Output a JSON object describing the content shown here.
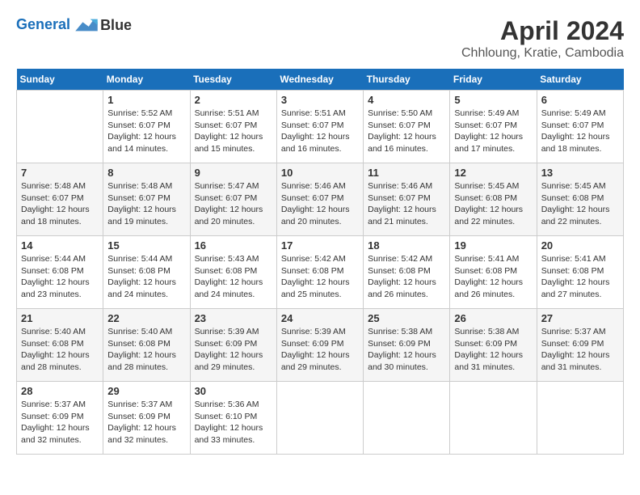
{
  "header": {
    "logo_line1": "General",
    "logo_line2": "Blue",
    "month_title": "April 2024",
    "location": "Chhloung, Kratie, Cambodia"
  },
  "weekdays": [
    "Sunday",
    "Monday",
    "Tuesday",
    "Wednesday",
    "Thursday",
    "Friday",
    "Saturday"
  ],
  "weeks": [
    [
      {
        "day": "",
        "info": ""
      },
      {
        "day": "1",
        "info": "Sunrise: 5:52 AM\nSunset: 6:07 PM\nDaylight: 12 hours\nand 14 minutes."
      },
      {
        "day": "2",
        "info": "Sunrise: 5:51 AM\nSunset: 6:07 PM\nDaylight: 12 hours\nand 15 minutes."
      },
      {
        "day": "3",
        "info": "Sunrise: 5:51 AM\nSunset: 6:07 PM\nDaylight: 12 hours\nand 16 minutes."
      },
      {
        "day": "4",
        "info": "Sunrise: 5:50 AM\nSunset: 6:07 PM\nDaylight: 12 hours\nand 16 minutes."
      },
      {
        "day": "5",
        "info": "Sunrise: 5:49 AM\nSunset: 6:07 PM\nDaylight: 12 hours\nand 17 minutes."
      },
      {
        "day": "6",
        "info": "Sunrise: 5:49 AM\nSunset: 6:07 PM\nDaylight: 12 hours\nand 18 minutes."
      }
    ],
    [
      {
        "day": "7",
        "info": "Sunrise: 5:48 AM\nSunset: 6:07 PM\nDaylight: 12 hours\nand 18 minutes."
      },
      {
        "day": "8",
        "info": "Sunrise: 5:48 AM\nSunset: 6:07 PM\nDaylight: 12 hours\nand 19 minutes."
      },
      {
        "day": "9",
        "info": "Sunrise: 5:47 AM\nSunset: 6:07 PM\nDaylight: 12 hours\nand 20 minutes."
      },
      {
        "day": "10",
        "info": "Sunrise: 5:46 AM\nSunset: 6:07 PM\nDaylight: 12 hours\nand 20 minutes."
      },
      {
        "day": "11",
        "info": "Sunrise: 5:46 AM\nSunset: 6:07 PM\nDaylight: 12 hours\nand 21 minutes."
      },
      {
        "day": "12",
        "info": "Sunrise: 5:45 AM\nSunset: 6:08 PM\nDaylight: 12 hours\nand 22 minutes."
      },
      {
        "day": "13",
        "info": "Sunrise: 5:45 AM\nSunset: 6:08 PM\nDaylight: 12 hours\nand 22 minutes."
      }
    ],
    [
      {
        "day": "14",
        "info": "Sunrise: 5:44 AM\nSunset: 6:08 PM\nDaylight: 12 hours\nand 23 minutes."
      },
      {
        "day": "15",
        "info": "Sunrise: 5:44 AM\nSunset: 6:08 PM\nDaylight: 12 hours\nand 24 minutes."
      },
      {
        "day": "16",
        "info": "Sunrise: 5:43 AM\nSunset: 6:08 PM\nDaylight: 12 hours\nand 24 minutes."
      },
      {
        "day": "17",
        "info": "Sunrise: 5:42 AM\nSunset: 6:08 PM\nDaylight: 12 hours\nand 25 minutes."
      },
      {
        "day": "18",
        "info": "Sunrise: 5:42 AM\nSunset: 6:08 PM\nDaylight: 12 hours\nand 26 minutes."
      },
      {
        "day": "19",
        "info": "Sunrise: 5:41 AM\nSunset: 6:08 PM\nDaylight: 12 hours\nand 26 minutes."
      },
      {
        "day": "20",
        "info": "Sunrise: 5:41 AM\nSunset: 6:08 PM\nDaylight: 12 hours\nand 27 minutes."
      }
    ],
    [
      {
        "day": "21",
        "info": "Sunrise: 5:40 AM\nSunset: 6:08 PM\nDaylight: 12 hours\nand 28 minutes."
      },
      {
        "day": "22",
        "info": "Sunrise: 5:40 AM\nSunset: 6:08 PM\nDaylight: 12 hours\nand 28 minutes."
      },
      {
        "day": "23",
        "info": "Sunrise: 5:39 AM\nSunset: 6:09 PM\nDaylight: 12 hours\nand 29 minutes."
      },
      {
        "day": "24",
        "info": "Sunrise: 5:39 AM\nSunset: 6:09 PM\nDaylight: 12 hours\nand 29 minutes."
      },
      {
        "day": "25",
        "info": "Sunrise: 5:38 AM\nSunset: 6:09 PM\nDaylight: 12 hours\nand 30 minutes."
      },
      {
        "day": "26",
        "info": "Sunrise: 5:38 AM\nSunset: 6:09 PM\nDaylight: 12 hours\nand 31 minutes."
      },
      {
        "day": "27",
        "info": "Sunrise: 5:37 AM\nSunset: 6:09 PM\nDaylight: 12 hours\nand 31 minutes."
      }
    ],
    [
      {
        "day": "28",
        "info": "Sunrise: 5:37 AM\nSunset: 6:09 PM\nDaylight: 12 hours\nand 32 minutes."
      },
      {
        "day": "29",
        "info": "Sunrise: 5:37 AM\nSunset: 6:09 PM\nDaylight: 12 hours\nand 32 minutes."
      },
      {
        "day": "30",
        "info": "Sunrise: 5:36 AM\nSunset: 6:10 PM\nDaylight: 12 hours\nand 33 minutes."
      },
      {
        "day": "",
        "info": ""
      },
      {
        "day": "",
        "info": ""
      },
      {
        "day": "",
        "info": ""
      },
      {
        "day": "",
        "info": ""
      }
    ]
  ]
}
